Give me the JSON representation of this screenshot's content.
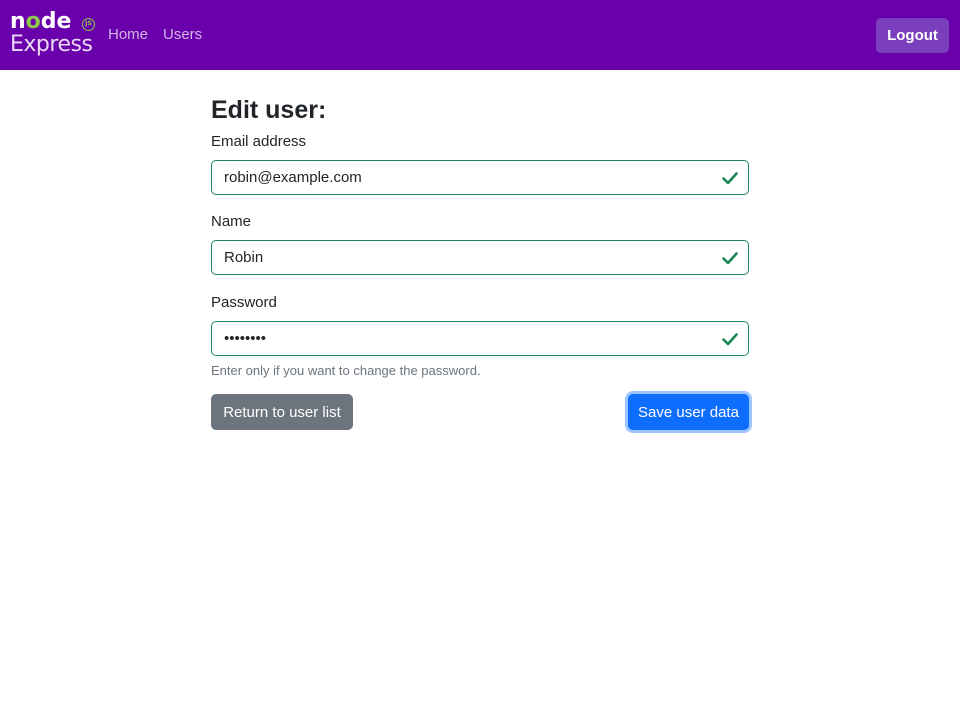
{
  "navbar": {
    "logo_node": "node",
    "logo_js": "JS",
    "logo_express": "Express",
    "links": [
      "Home",
      "Users"
    ],
    "logout_label": "Logout"
  },
  "page": {
    "title": "Edit user:"
  },
  "form": {
    "email_label": "Email address",
    "email_value": "robin@example.com",
    "name_label": "Name",
    "name_value": "Robin",
    "password_label": "Password",
    "password_value": "password",
    "password_hint": "Enter only if you want to change the password.",
    "return_label": "Return to user list",
    "save_label": "Save user data",
    "valid_icon": "check-icon"
  },
  "colors": {
    "navbar": "#6a00ab",
    "valid": "#198754",
    "primary": "#0d6efd",
    "secondary": "#6c757d"
  }
}
